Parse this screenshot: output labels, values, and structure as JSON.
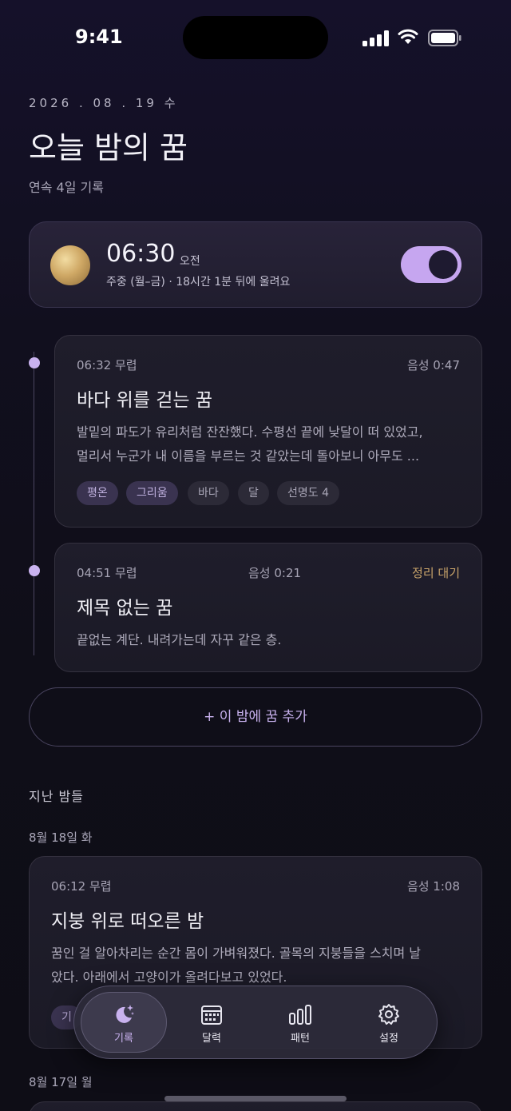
{
  "status_bar": {
    "time": "9:41"
  },
  "header": {
    "date": "2026 . 08 . 19 수",
    "title": "오늘 밤의 꿈",
    "streak": "연속 4일 기록"
  },
  "alarm": {
    "time": "06:30",
    "ampm": "오전",
    "subtitle": "주중 (월–금) · 18시간 1분 뒤에 울려요",
    "enabled": true
  },
  "tonight_dreams": [
    {
      "time": "06:32 무렵",
      "voice": "음성 0:47",
      "title": "바다 위를 걷는 꿈",
      "body_line1": "발밑의 파도가 유리처럼 잔잔했다. 수평선 끝에 낮달이 떠 있었고,",
      "body_line2": "멀리서 누군가 내 이름을 부르는 것 같았는데 돌아보니 아무도 ...",
      "tags": [
        "평온",
        "그리움",
        "바다",
        "달",
        "선명도 4"
      ]
    },
    {
      "time": "04:51 무렵",
      "voice": "음성 0:21",
      "status": "정리 대기",
      "title": "제목 없는 꿈",
      "body_line1": "끝없는 계단. 내려가는데 자꾸 같은 층."
    }
  ],
  "add_button": "+ 이 밤에 꿈 추가",
  "past": {
    "section_title": "지난 밤들",
    "day1": {
      "label": "8월 18일 화",
      "dream": {
        "time": "06:12 무렵",
        "voice": "음성 1:08",
        "title": "지붕 위로 떠오른 밤",
        "body_line1": "꿈인 걸 알아차리는 순간 몸이 가벼워졌다. 골목의 지붕들을 스치며 날",
        "body_line2": "았다. 아래에서 고양이가 올려다보고 있었다.",
        "tag_partial": "기"
      }
    },
    "day2": {
      "label": "8월 17일 월"
    }
  },
  "tabbar": {
    "tabs": [
      {
        "label": "기록",
        "icon": "moon-stars-icon"
      },
      {
        "label": "달력",
        "icon": "calendar-icon"
      },
      {
        "label": "패턴",
        "icon": "bar-chart-icon"
      },
      {
        "label": "설정",
        "icon": "gear-icon"
      }
    ]
  },
  "colors": {
    "accent": "#c9b2ef",
    "pending": "#c8a36a",
    "background": "#110f1e"
  }
}
